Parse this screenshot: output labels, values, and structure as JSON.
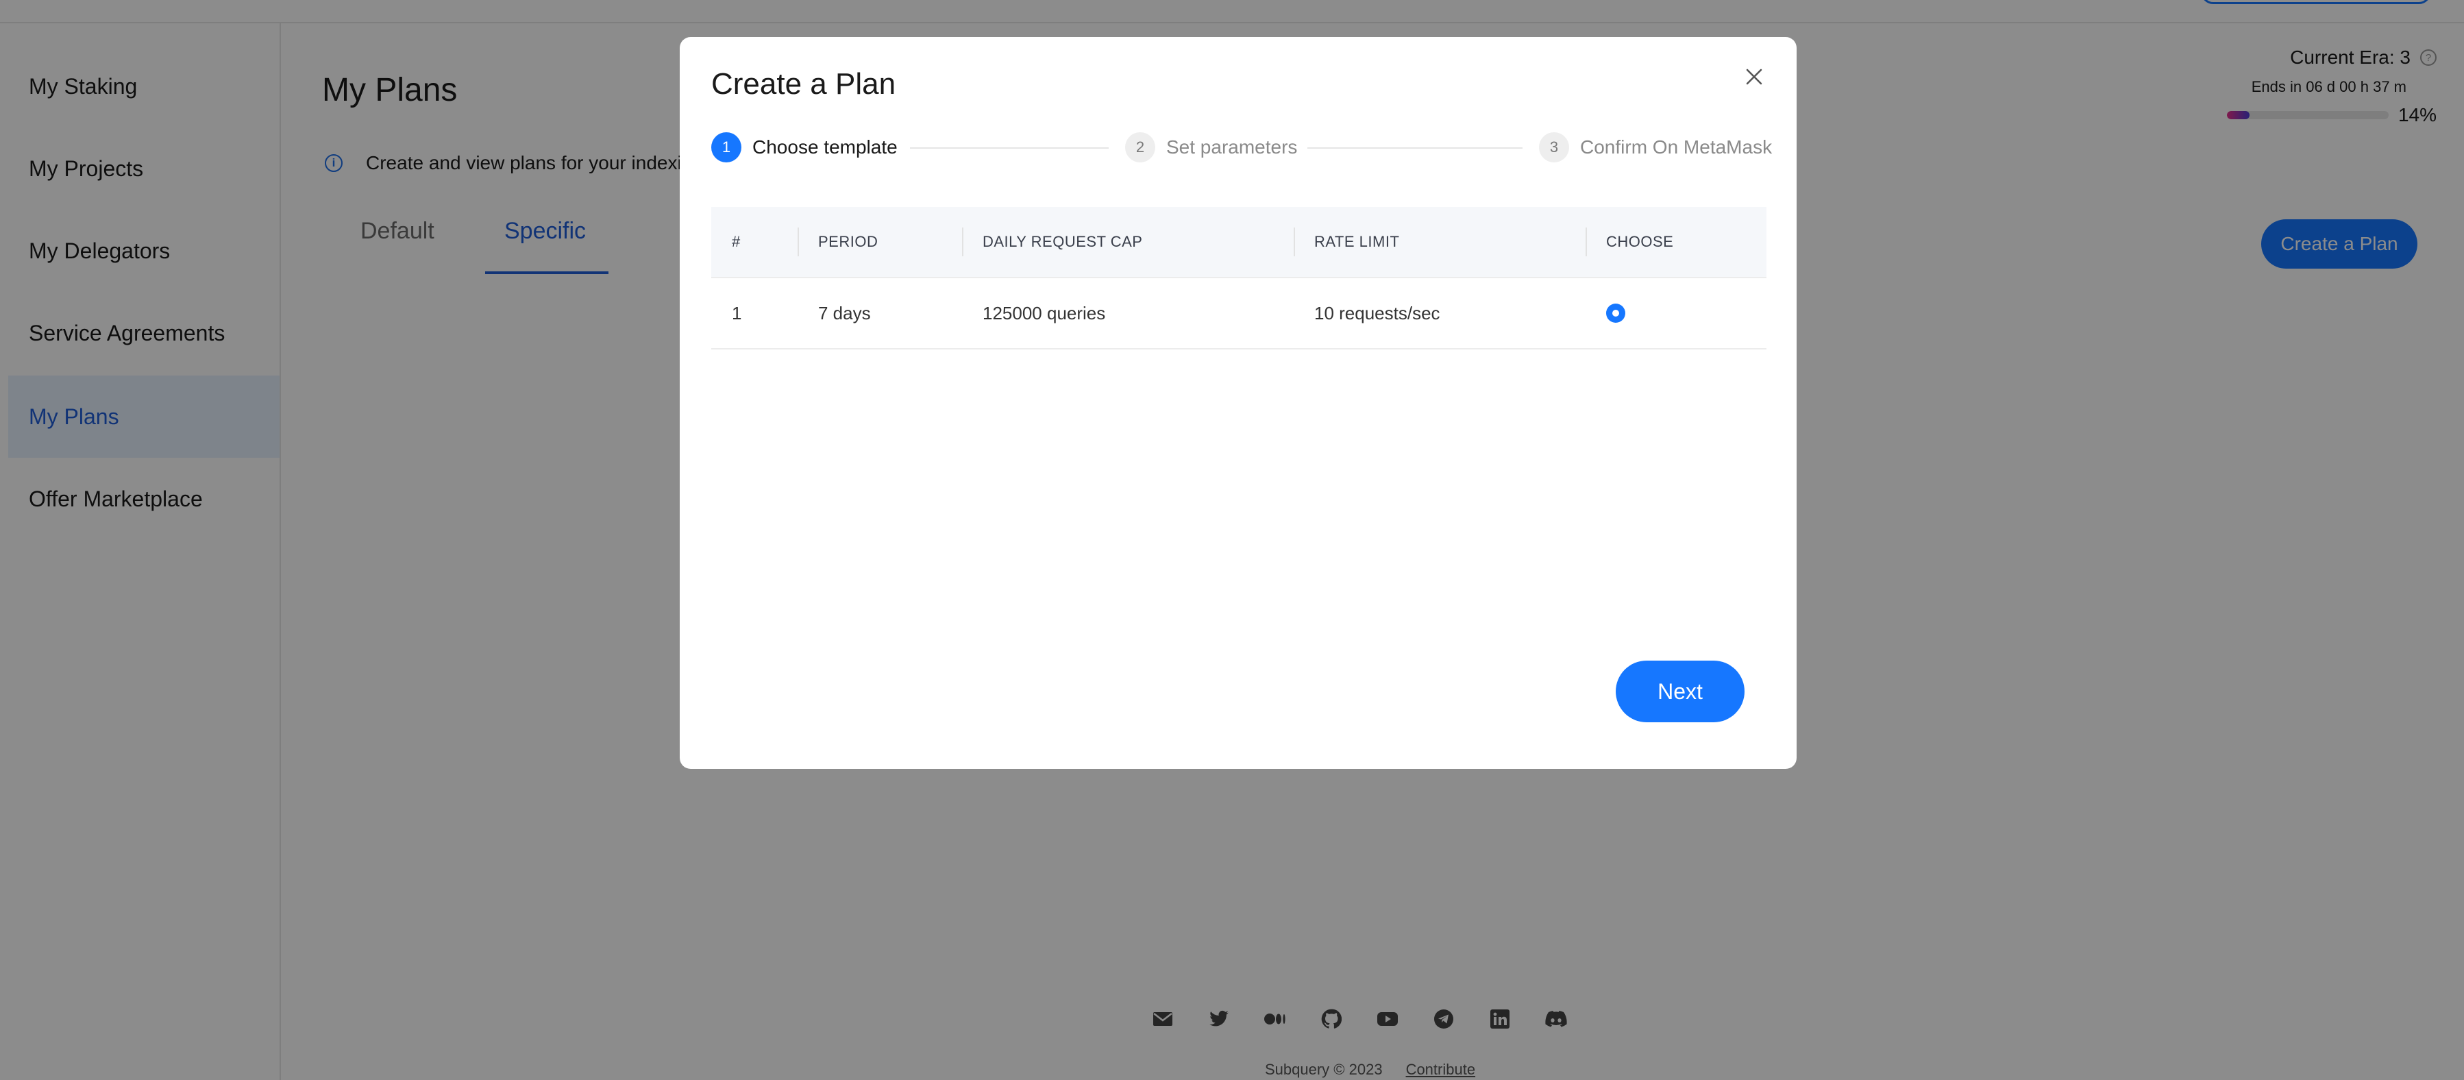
{
  "sidebar": {
    "items": [
      {
        "label": "My Staking"
      },
      {
        "label": "My Projects"
      },
      {
        "label": "My Delegators"
      },
      {
        "label": "Service Agreements"
      },
      {
        "label": "My Plans",
        "active": true
      },
      {
        "label": "Offer Marketplace"
      }
    ]
  },
  "page": {
    "title": "My Plans",
    "info_text": "Create and view plans for your indexi",
    "tabs": [
      {
        "label": "Default"
      },
      {
        "label": "Specific",
        "active": true
      }
    ],
    "create_button": "Create a Plan"
  },
  "era": {
    "title": "Current Era: 3",
    "ends": "Ends in 06 d 00 h 37 m",
    "progress_percent": 14,
    "progress_label": "14%"
  },
  "modal": {
    "title": "Create a Plan",
    "steps": [
      {
        "num": "1",
        "label": "Choose template",
        "active": true
      },
      {
        "num": "2",
        "label": "Set parameters",
        "active": false
      },
      {
        "num": "3",
        "label": "Confirm On MetaMask",
        "active": false
      }
    ],
    "table": {
      "headers": [
        "#",
        "PERIOD",
        "DAILY REQUEST CAP",
        "RATE LIMIT",
        "CHOOSE"
      ],
      "rows": [
        {
          "num": "1",
          "period": "7 days",
          "cap": "125000 queries",
          "rate": "10 requests/sec",
          "selected": true
        }
      ]
    },
    "next_button": "Next"
  },
  "footer": {
    "icons": [
      "mail-icon",
      "twitter-icon",
      "medium-icon",
      "github-icon",
      "youtube-icon",
      "telegram-icon",
      "linkedin-icon",
      "discord-icon"
    ],
    "copyright": "Subquery © 2023",
    "link": "Contribute"
  },
  "colors": {
    "accent": "#1677ff",
    "active_text": "#1f5ed8",
    "active_bg": "#e6f0fe",
    "overlay": "rgba(0,0,0,0.45)"
  }
}
